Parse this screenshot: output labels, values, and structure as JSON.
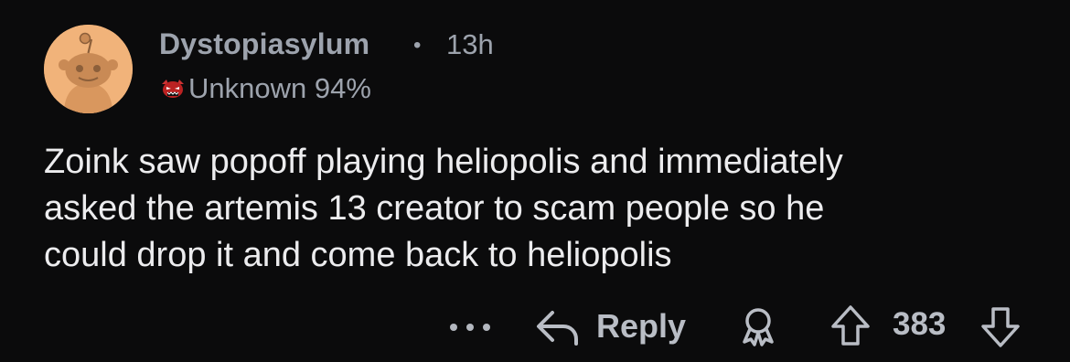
{
  "comment": {
    "author": "Dystopiasylum",
    "separator": "•",
    "timestamp": "13h",
    "flair": {
      "icon": "demon-difficulty-face-icon",
      "text": "Unknown 94%"
    },
    "body_lines": [
      "Zoink saw popoff playing heliopolis and immediately",
      "asked the artemis 13 creator to scam people so he",
      "could drop it and come back to heliopolis"
    ]
  },
  "actions": {
    "more_icon": "more-dots-icon",
    "reply_label": "Reply",
    "award_icon": "award-icon",
    "score": "383"
  },
  "colors": {
    "background": "#0b0b0c",
    "meta_text": "#9da3ad",
    "body_text": "#ececee",
    "action_text": "#b9bdc5",
    "avatar_bg": "#f1b37a"
  }
}
